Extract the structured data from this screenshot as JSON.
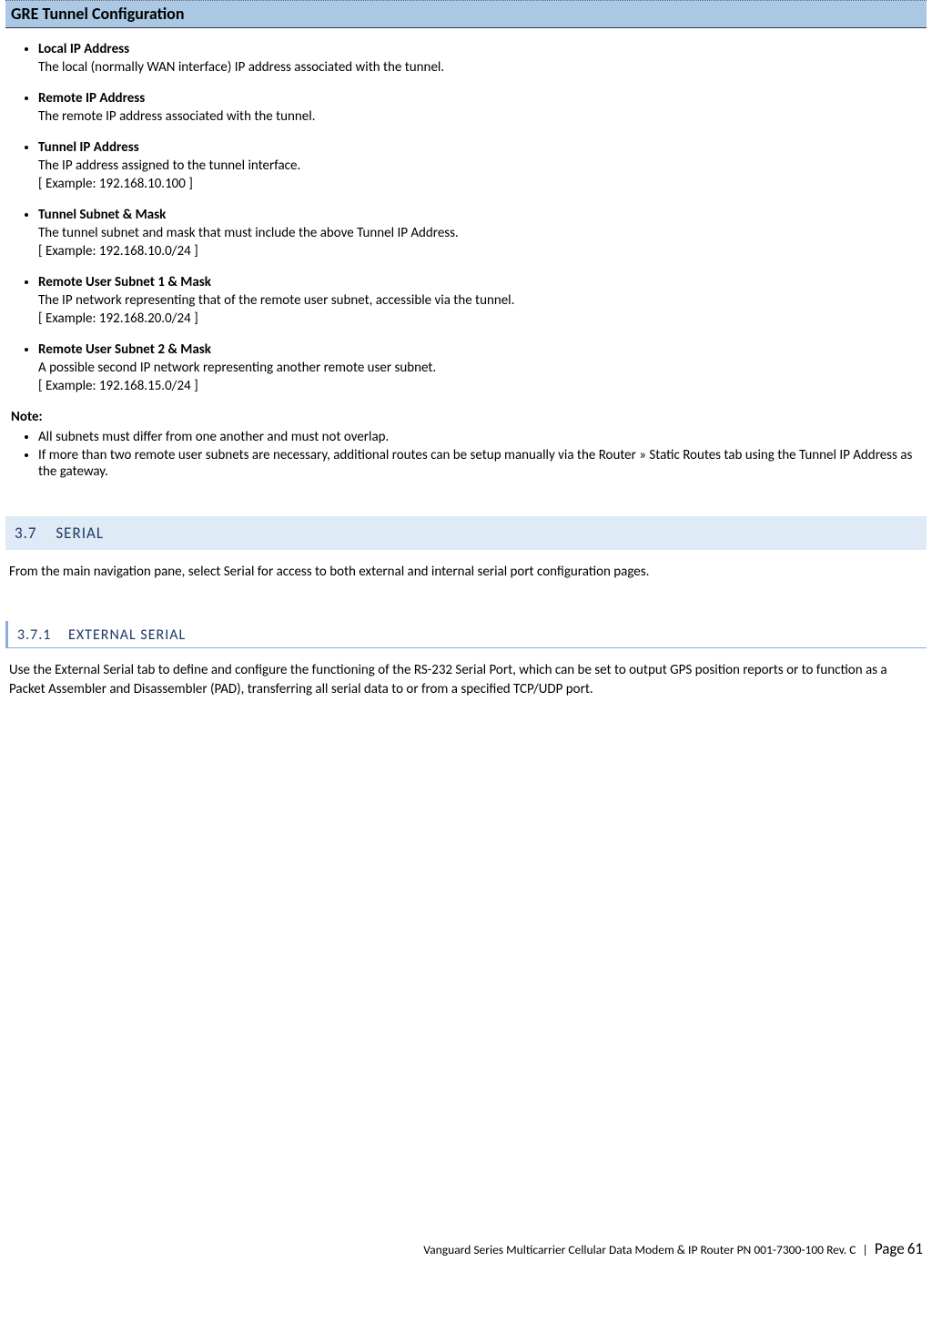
{
  "banner_title": "GRE Tunnel Configuration",
  "params": [
    {
      "title": "Local IP Address",
      "desc": "The local (normally WAN interface) IP address associated with the tunnel.",
      "example": ""
    },
    {
      "title": "Remote IP Address",
      "desc": "The remote IP address associated with the tunnel.",
      "example": ""
    },
    {
      "title": "Tunnel IP Address",
      "desc": "The IP address assigned to the tunnel interface.",
      "example": "[ Example: 192.168.10.100 ]"
    },
    {
      "title": "Tunnel Subnet & Mask",
      "desc": "The tunnel subnet and mask that must include the above Tunnel IP Address.",
      "example": "[ Example: 192.168.10.0/24 ]"
    },
    {
      "title": "Remote User Subnet 1 & Mask",
      "desc": "The IP network representing that of the remote user subnet, accessible via the tunnel.",
      "example": "[ Example: 192.168.20.0/24 ]"
    },
    {
      "title": "Remote User Subnet 2 & Mask",
      "desc": "A possible second IP network representing another remote user subnet.",
      "example": "[ Example: 192.168.15.0/24 ]"
    }
  ],
  "note_label": "Note:",
  "notes": [
    "All subnets must differ from one another and must not overlap.",
    "If more than two remote user subnets are necessary, additional routes can be setup manually via the Router » Static Routes tab using the Tunnel IP Address as the gateway."
  ],
  "h2": {
    "num": "3.7",
    "text": "SERIAL"
  },
  "h2_para": "From the main navigation pane, select Serial for access to both external and internal serial port configuration pages.",
  "h3": {
    "num": "3.7.1",
    "text": "EXTERNAL SERIAL"
  },
  "h3_para": "Use the External Serial tab to define and configure the functioning of the RS-232 Serial Port, which can be set to output GPS position reports or to function as a Packet Assembler and Disassembler (PAD), transferring all serial data to or from a specified TCP/UDP port.",
  "footer": {
    "doc": "Vanguard Series Multicarrier Cellular Data Modem & IP Router PN 001-7300-100 Rev. C",
    "page_label": "Page",
    "page_num": "61"
  }
}
